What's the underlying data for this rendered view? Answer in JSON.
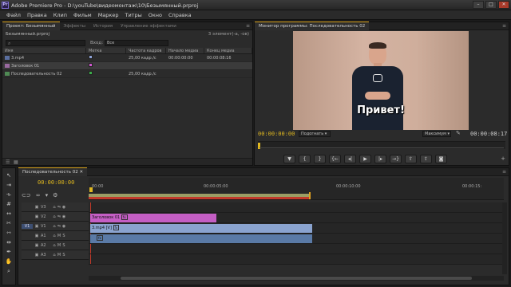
{
  "window": {
    "title": "Adobe Premiere Pro - D:\\youTube\\видеомонтаж\\10\\Безымянный.prproj",
    "app_icon": "Pr",
    "controls": [
      "–",
      "□",
      "✕"
    ]
  },
  "menu": [
    "Файл",
    "Правка",
    "Клип",
    "Фильм",
    "Маркер",
    "Титры",
    "Окно",
    "Справка"
  ],
  "project_panel": {
    "tabs": [
      "Проект: Безымянный",
      "Эффекты",
      "История",
      "Управление эффектами"
    ],
    "project_name": "Безымянный.prproj",
    "item_count": "3 элемент(-а, -ов)",
    "search_placeholder": "",
    "input_label": "Вход:",
    "input_value": "Все",
    "columns": [
      "Имя",
      "Метка",
      "Частота кадров",
      "Начало медиа",
      "Конец медиа"
    ],
    "rows": [
      {
        "name": "3.mp4",
        "label_color": "#8fa3d8",
        "fps": "25,00 кадр./с",
        "start": "00:00:00:00",
        "end": "00:00:08:16",
        "kind": "video"
      },
      {
        "name": "Заголовок 01",
        "label_color": "#d058d0",
        "fps": "",
        "start": "",
        "end": "",
        "kind": "title"
      },
      {
        "name": "Последовательность 02",
        "label_color": "#3cae4a",
        "fps": "25,00 кадр./с",
        "start": "",
        "end": "",
        "kind": "sequence"
      }
    ]
  },
  "program_monitor": {
    "tab": "Монитор программы: Последовательность 02",
    "caption": "Привет!",
    "current_tc": "00:00:00:00",
    "fit": "Подогнать",
    "quality": "Максимум",
    "duration_tc": "00:00:08:17"
  },
  "timeline": {
    "tab": "Последовательность 02",
    "current_tc": "00:00:00:00",
    "ruler": [
      "00:00",
      "00:00:05:00",
      "00:00:10:00",
      "00:00:15:"
    ],
    "tracks": [
      {
        "id": "V3",
        "clip": ""
      },
      {
        "id": "V2",
        "clip": "Заголовок 01"
      },
      {
        "id": "V1",
        "clip": "3.mp4 [V]"
      },
      {
        "id": "A1",
        "clip": ""
      },
      {
        "id": "A2",
        "clip": ""
      },
      {
        "id": "A3",
        "clip": ""
      }
    ],
    "source_patch": "V1",
    "fx_badge": "fx",
    "track_flags": [
      "M",
      "S"
    ]
  },
  "tools": [
    "selection-icon",
    "track-select-icon",
    "ripple-icon",
    "rolling-icon",
    "rate-stretch-icon",
    "razor-icon",
    "slip-icon",
    "slide-icon",
    "pen-icon",
    "hand-icon",
    "zoom-icon"
  ]
}
